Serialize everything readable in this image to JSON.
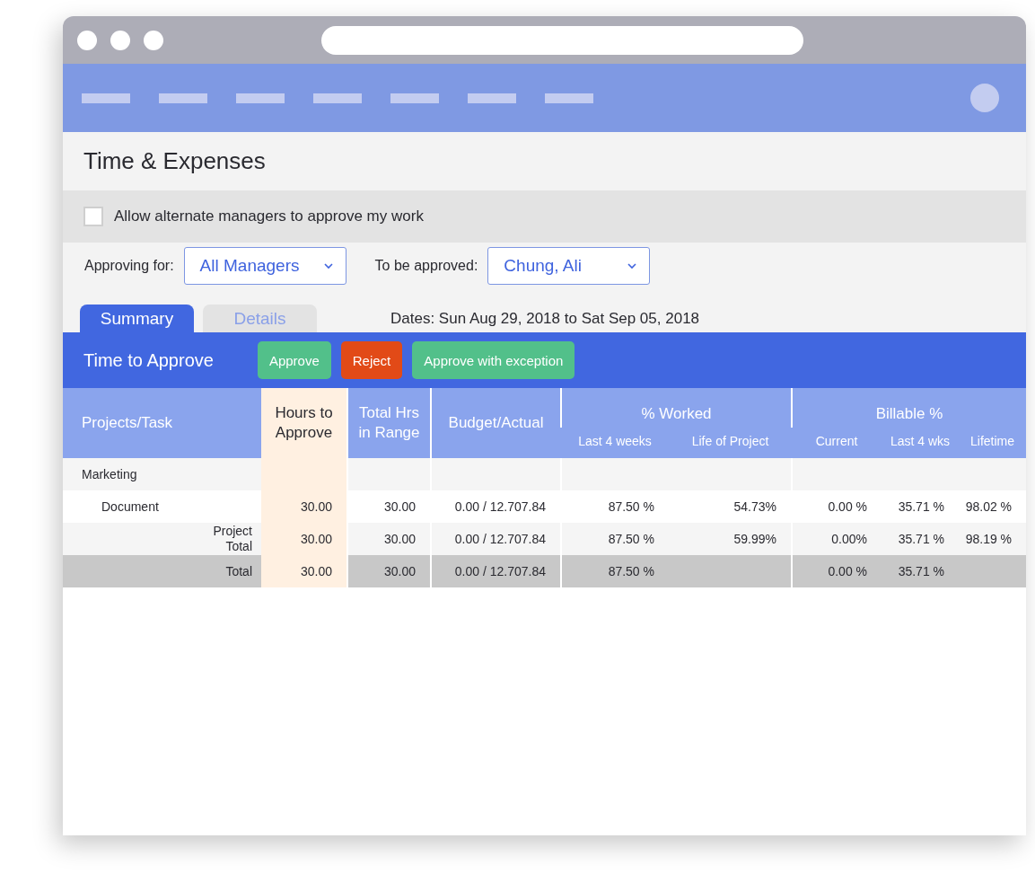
{
  "page": {
    "title": "Time & Expenses"
  },
  "alternate_managers": {
    "label": "Allow alternate managers to approve my work",
    "checked": false
  },
  "filters": [
    {
      "label": "Approving for:",
      "value": "All Managers"
    },
    {
      "label": "To be approved:",
      "value": "Chung, Ali"
    }
  ],
  "tabs": [
    {
      "label": "Summary",
      "selected": true
    },
    {
      "label": "Details",
      "selected": false
    }
  ],
  "dates": "Dates: Sun Aug 29, 2018 to Sat Sep 05, 2018",
  "toolbar": {
    "title": "Time to Approve",
    "buttons": [
      {
        "label": "Approve",
        "kind": "approve"
      },
      {
        "label": "Reject",
        "kind": "reject"
      },
      {
        "label": "Approve with exception",
        "kind": "approve"
      }
    ]
  },
  "table": {
    "header_groups": [
      {
        "label": "Projects/Task",
        "highlighted": false
      },
      {
        "label": "Hours to Approve",
        "highlighted": true
      },
      {
        "label": "Total Hrs in Range",
        "highlighted": false
      },
      {
        "label": "Budget/Actual",
        "highlighted": false
      },
      {
        "label": "% Worked",
        "highlighted": false,
        "children": [
          {
            "label": "Last 4 weeks"
          },
          {
            "label": "Life of Project"
          }
        ]
      },
      {
        "label": "Billable %",
        "highlighted": false,
        "children": [
          {
            "label": "Current"
          },
          {
            "label": "Last 4 wks"
          },
          {
            "label": "Lifetime"
          }
        ]
      }
    ],
    "rows": [
      {
        "kind": "group",
        "cells": [
          "Marketing",
          null,
          null,
          null,
          null,
          null,
          null,
          null,
          null
        ]
      },
      {
        "kind": "task",
        "cells": [
          "Document",
          "30.00",
          "30.00",
          "0.00 / 12.707.84",
          "87.50 %",
          "54.73%",
          "0.00 %",
          "35.71 %",
          "98.02 %"
        ]
      },
      {
        "kind": "subtotal",
        "cells": [
          "Project Total",
          "30.00",
          "30.00",
          "0.00 / 12.707.84",
          "87.50 %",
          "59.99%",
          "0.00%",
          "35.71 %",
          "98.19 %"
        ]
      },
      {
        "kind": "total",
        "cells": [
          "Total",
          "30.00",
          "30.00",
          "0.00 / 12.707.84",
          "87.50 %",
          null,
          "0.00 %",
          "35.71 %",
          null
        ]
      }
    ]
  }
}
